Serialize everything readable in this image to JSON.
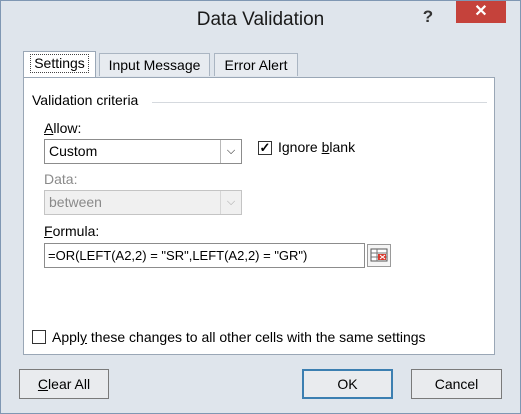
{
  "dialog": {
    "title": "Data Validation",
    "help": "?",
    "close": "✕"
  },
  "tabs": [
    {
      "label": "Settings"
    },
    {
      "label": "Input Message"
    },
    {
      "label": "Error Alert"
    }
  ],
  "criteria": {
    "title": "Validation criteria",
    "allow_label_pre": "",
    "allow_label_u": "A",
    "allow_label_post": "llow:",
    "allow_value": "Custom",
    "ignore_blank_pre": "Ignore ",
    "ignore_blank_u": "b",
    "ignore_blank_post": "lank",
    "ignore_blank_checked": true,
    "data_label": "Data:",
    "data_value": "between",
    "formula_label_u": "F",
    "formula_label_post": "ormula:",
    "formula_value": "=OR(LEFT(A2,2) = \"SR\",LEFT(A2,2) = \"GR\")"
  },
  "apply": {
    "label_pre": "Appl",
    "label_u": "y",
    "label_post": " these changes to all other cells with the same settings",
    "checked": false
  },
  "buttons": {
    "clear_u": "C",
    "clear_post": "lear All",
    "ok": "OK",
    "cancel": "Cancel"
  }
}
